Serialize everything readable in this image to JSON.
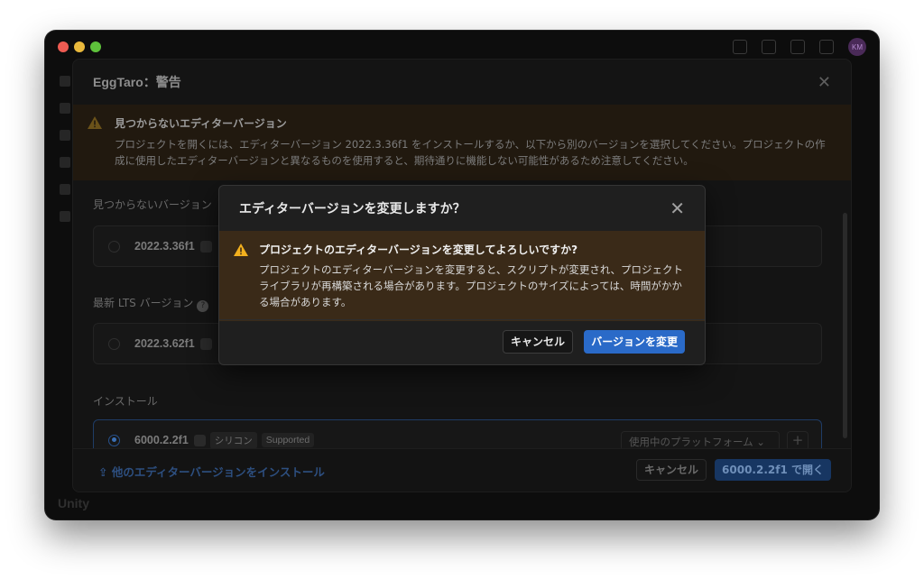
{
  "window": {
    "app_label": "Unity",
    "avatar_initials": "KM"
  },
  "warning_dialog": {
    "title": "EggTaro：警告",
    "banner_title": "見つからないエディターバージョン",
    "banner_text": "プロジェクトを開くには、エディターバージョン 2022.3.36f1 をインストールするか、以下から別のバージョンを選択してください。プロジェクトの作成に使用したエディターバージョンと異なるものを使用すると、期待通りに機能しない可能性があるため注意してください。",
    "missing_label": "見つからないバージョン",
    "missing_version": "2022.3.36f1",
    "lts_label": "最新 LTS バージョン",
    "lts_help": "?",
    "lts_version": "2022.3.62f1",
    "installed_label": "インストール",
    "installed_version": "6000.2.2f1",
    "installed_chip_arch": "シリコン",
    "installed_chip_status": "Supported",
    "platform_select": "使用中のプラットフォーム ⌄",
    "plus": "+",
    "install_other_link": "他のエディターバージョンをインストール",
    "cancel_label": "キャンセル",
    "open_label": "6000.2.2f1 で開く",
    "accent_color": "#2a6ac8"
  },
  "modal": {
    "title": "エディターバージョンを変更しますか？",
    "question": "プロジェクトのエディターバージョンを変更してよろしいですか?",
    "message": "プロジェクトのエディターバージョンを変更すると、スクリプトが変更され、プロジェクトライブラリが再構築される場合があります。プロジェクトのサイズによっては、時間がかかる場合があります。",
    "cancel_label": "キャンセル",
    "confirm_label": "バージョンを変更",
    "warning_color": "#f2b01e",
    "confirm_color": "#2a6ac8"
  },
  "icons": {
    "close": "close-icon",
    "warning": "warning-triangle-icon",
    "apple": "apple-icon",
    "install": "download-icon"
  }
}
